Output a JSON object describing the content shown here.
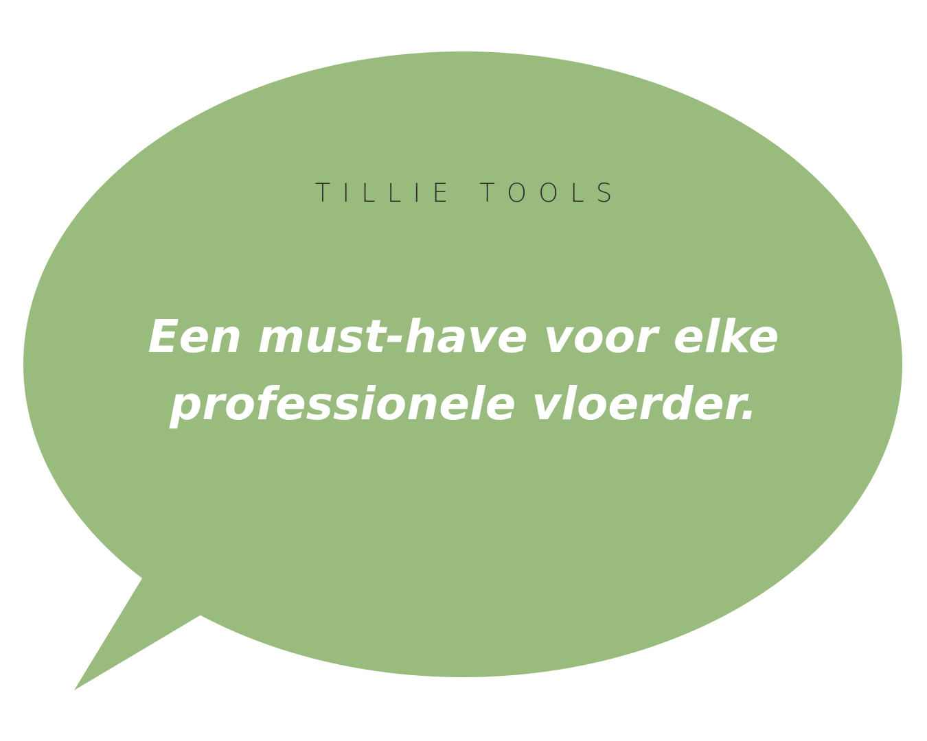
{
  "brand": {
    "name": "TILLIE TOOLS"
  },
  "quote": {
    "line1": "Een must-have voor elke",
    "line2": "professionele vloerder."
  },
  "colors": {
    "bubble": "#99bb7d",
    "quote_text": "#ffffff",
    "brand_text": "#2f2f2f",
    "background": "#ffffff"
  }
}
